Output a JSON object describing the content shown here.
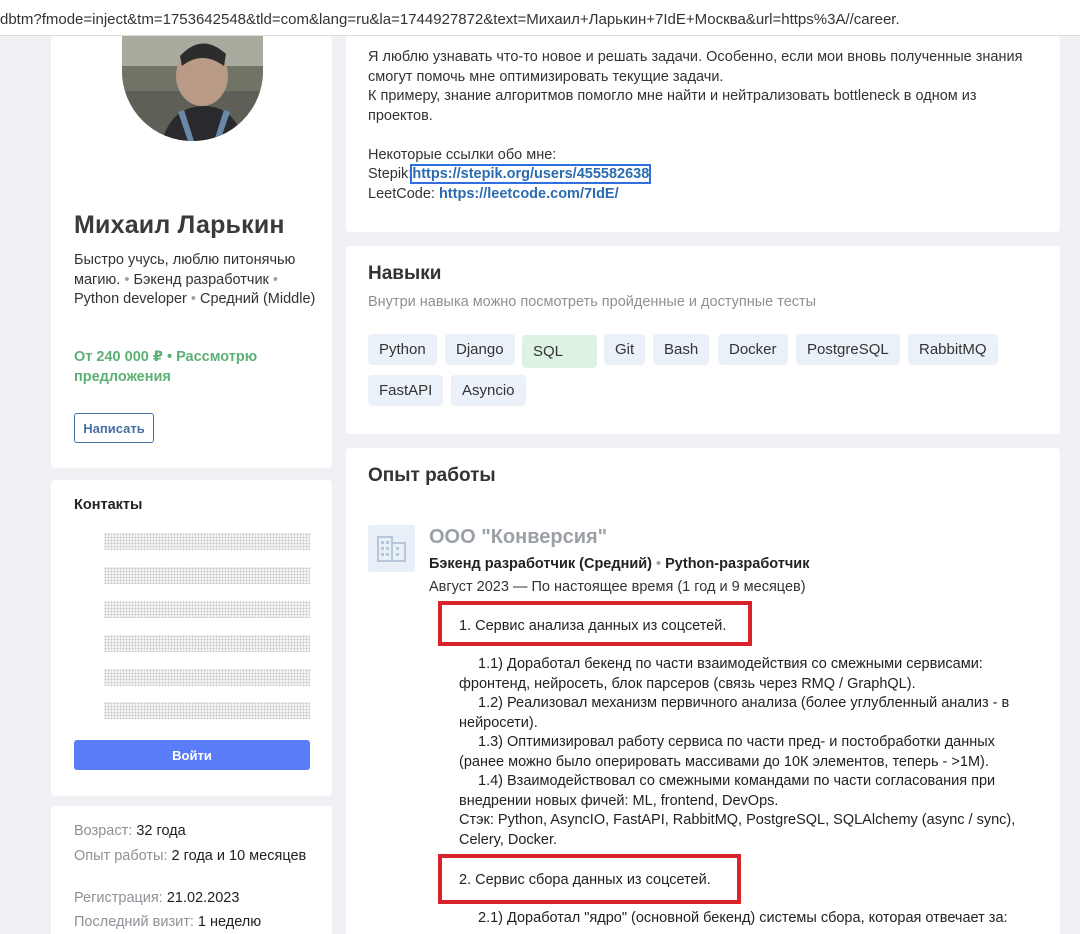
{
  "browser": {
    "url": "dbtm?fmode=inject&tm=1753642548&tld=com&lang=ru&la=1744927872&text=Михаил+Ларькин+7IdE+Москва&url=https%3A//career."
  },
  "profile": {
    "name": "Михаил Ларькин",
    "tagline_a": "Быстро учусь, люблю питонячью магию.",
    "tagline_b": "Бэкенд разработчик",
    "tagline_c": "Python developer",
    "tagline_d": "Средний (Middle)",
    "separator": "•",
    "salary": "От 240 000 ₽ • Рассмотрю предложения",
    "write_label": "Написать"
  },
  "contacts": {
    "title": "Контакты",
    "login_label": "Войти"
  },
  "info": {
    "age_label": "Возраст:",
    "age_value": "32 года",
    "exp_label": "Опыт работы:",
    "exp_value": "2 года и 10 месяцев",
    "reg_label": "Регистрация:",
    "reg_value": "21.02.2023",
    "visit_label": "Последний визит:",
    "visit_value": "1 неделю"
  },
  "about": {
    "p1": "Я люблю узнавать что-то новое и решать задачи. Особенно, если мои вновь полученные знания смогут помочь мне оптимизировать текущие задачи.",
    "p2": "К примеру, знание алгоритмов помогло мне найти и нейтрализовать bottleneck в одном из проектов.",
    "links_intro": "Некоторые ссылки обо мне:",
    "stepik_label": "Stepik:",
    "stepik_url": "https://stepik.org/users/455582638",
    "leetcode_label": "LeetCode:",
    "leetcode_url": "https://leetcode.com/7IdE/"
  },
  "skills": {
    "title": "Навыки",
    "subtitle": "Внутри навыка можно посмотреть пройденные и доступные тесты",
    "items": [
      "Python",
      "Django",
      "SQL",
      "Git",
      "Bash",
      "Docker",
      "PostgreSQL",
      "RabbitMQ",
      "FastAPI",
      "Asyncio"
    ]
  },
  "experience": {
    "title": "Опыт работы",
    "company": "ООО \"Конверсия\"",
    "position_a": "Бэкенд разработчик (Средний)",
    "position_b": "Python-разработчик",
    "period": "Август 2023 — По настоящее время (1 год и 9 месяцев)",
    "s1_title": "1. Сервис анализа данных из соцсетей.",
    "s1_1": "1.1) Доработал бекенд по части взаимодействия со смежными сервисами: фронтенд, нейросеть, блок парсеров (связь через RMQ / GraphQL).",
    "s1_2": "1.2) Реализовал механизм первичного анализа (более углубленный анализ - в нейросети).",
    "s1_3": "1.3) Оптимизировал работу сервиса по части пред- и постобработки данных (ранее можно было оперировать массивами до 10К элементов, теперь - >1M).",
    "s1_4": "1.4) Взаимодействовал со смежными командами по части согласования при внедрении новых фичей: ML, frontend, DevOps.",
    "s1_stack": "Стэк: Python, AsyncIO, FastAPI, RabbitMQ, PostgreSQL, SQLAlchemy (async / sync), Celery, Docker.",
    "s2_title": "2. Сервис сбора данных из соцсетей.",
    "s2_1": "2.1) Доработал \"ядро\" (основной бекенд) системы сбора, которая отвечает за:"
  },
  "colors": {
    "accent": "#5b7cf9",
    "salary": "#5db075",
    "link": "#2b6cb0",
    "highlight_box": "#d8232a",
    "skill_bg": "#ebf1f8",
    "skill_highlight_bg": "#ddf2e3"
  }
}
